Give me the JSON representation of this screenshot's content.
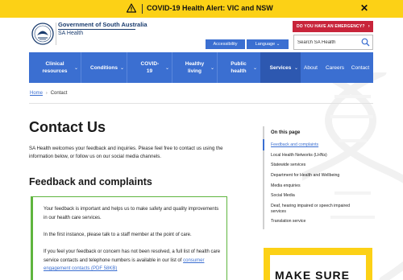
{
  "alert": {
    "icon": "warning-icon",
    "text": "COVID-19 Health Alert: VIC and NSW",
    "close_icon": "close-icon",
    "color": "#fcd116"
  },
  "header": {
    "org_name": "Government of South Australia",
    "site_name": "SA Health",
    "emergency_label": "DO YOU HAVE AN EMERGENCY?",
    "accessibility_label": "Accessibility",
    "language_label": "Language",
    "search_placeholder": "Search SA Health",
    "accent": "#3b6fd1",
    "emergency_color": "#c8243a"
  },
  "nav": {
    "items": [
      {
        "label": "Clinical resources"
      },
      {
        "label": "Conditions"
      },
      {
        "label": "COVID-19"
      },
      {
        "label": "Healthy living"
      },
      {
        "label": "Public health"
      },
      {
        "label": "Services"
      },
      {
        "label": "About"
      },
      {
        "label": "Careers"
      },
      {
        "label": "Contact"
      }
    ]
  },
  "breadcrumb": {
    "home": "Home",
    "current": "Contact"
  },
  "main": {
    "title": "Contact Us",
    "intro": "SA Health welcomes your feedback and inquiries. Please feel free to contact us using the information below, or follow us on our social media channels.",
    "section_title": "Feedback and complaints",
    "box": {
      "p1": "Your feedback is important and helps us to make safety and quality improvements in our health care services.",
      "p2": "In the first instance, please talk to a staff member at the point of care.",
      "p3": "If you feel your feedback or concern has not been resolved, a full list of health care service contacts and telephone numbers is available in our list of",
      "p3_link": "consumer engagement contacts (PDF 58KB)",
      "border_color": "#5fb53e"
    }
  },
  "on_this_page": {
    "title": "On this page",
    "items": [
      "Feedback and complaints",
      "Local Health Networks (LHNs)",
      "Statewide services",
      "Department for Health and Wellbeing",
      "Media enquiries",
      "Social Media",
      "Deaf, hearing impaired or speech impaired",
      "services",
      "Translation service"
    ]
  },
  "promo": {
    "text": "MAKE SURE"
  }
}
